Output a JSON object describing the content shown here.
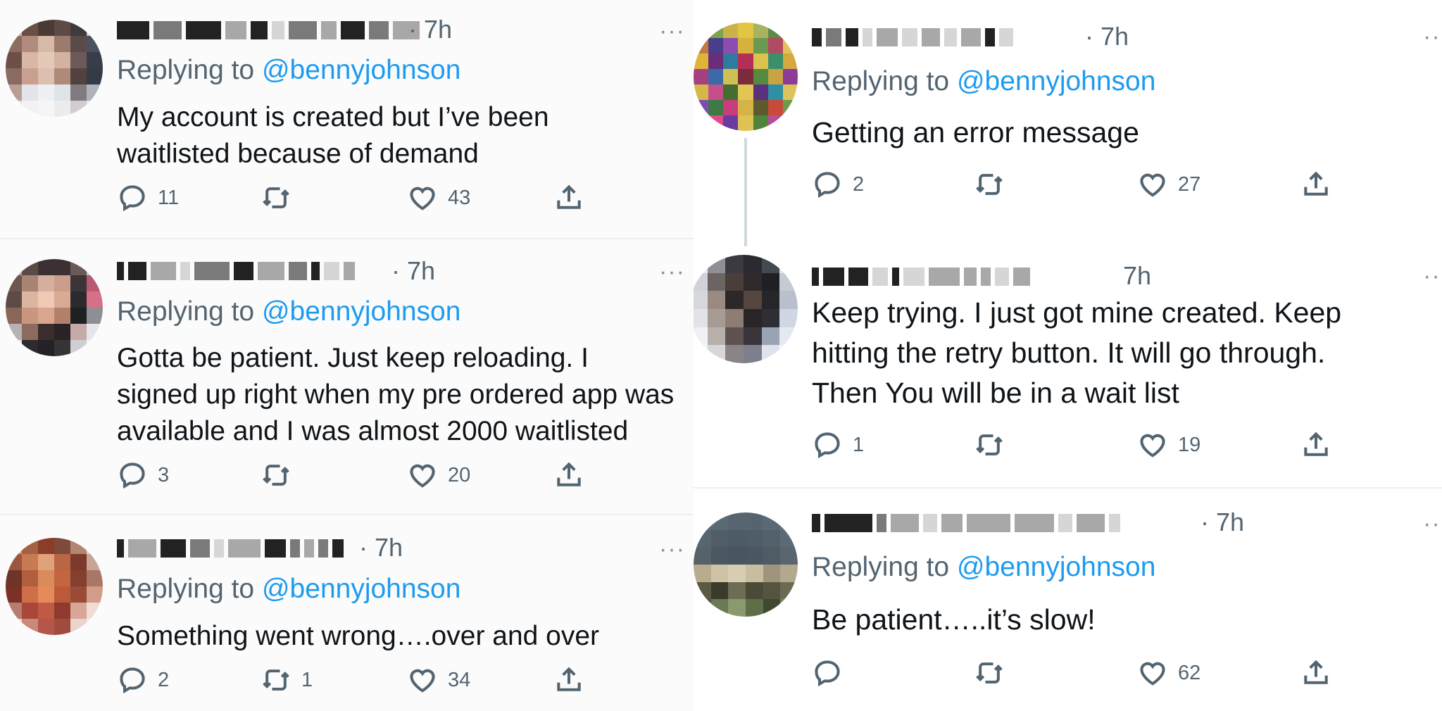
{
  "reply_prefix": "Replying to",
  "more_glyph": "···",
  "left_tweets": [
    {
      "time": "· 7h",
      "handle": "@bennyjohnson",
      "text_lines": [
        "My account is created but I’ve been",
        "waitlisted because of demand"
      ],
      "replies": "11",
      "retweets": "",
      "likes": "43"
    },
    {
      "time": "· 7h",
      "handle": "@bennyjohnson",
      "text_lines": [
        "Gotta be patient. Just keep reloading. I",
        "signed up right when my pre ordered app was",
        "available and I was almost 2000 waitlisted"
      ],
      "replies": "3",
      "retweets": "",
      "likes": "20"
    },
    {
      "time": "· 7h",
      "handle": "@bennyjohnson",
      "text_lines": [
        "Something went wrong….over and over"
      ],
      "replies": "2",
      "retweets": "1",
      "likes": "34"
    }
  ],
  "right_tweets": [
    {
      "time": "· 7h",
      "handle": "@bennyjohnson",
      "text_lines": [
        "Getting an error message"
      ],
      "replies": "2",
      "retweets": "",
      "likes": "27"
    },
    {
      "time": "7h",
      "handle": "",
      "text_lines": [
        "Keep trying.  I just got mine created.  Keep",
        "hitting the retry button. It will go through.",
        "Then You will be in a wait list"
      ],
      "replies": "1",
      "retweets": "",
      "likes": "19"
    },
    {
      "time": "· 7h",
      "handle": "@bennyjohnson",
      "text_lines": [
        "Be patient…..it’s slow!"
      ],
      "replies": "",
      "retweets": "",
      "likes": "62"
    }
  ]
}
